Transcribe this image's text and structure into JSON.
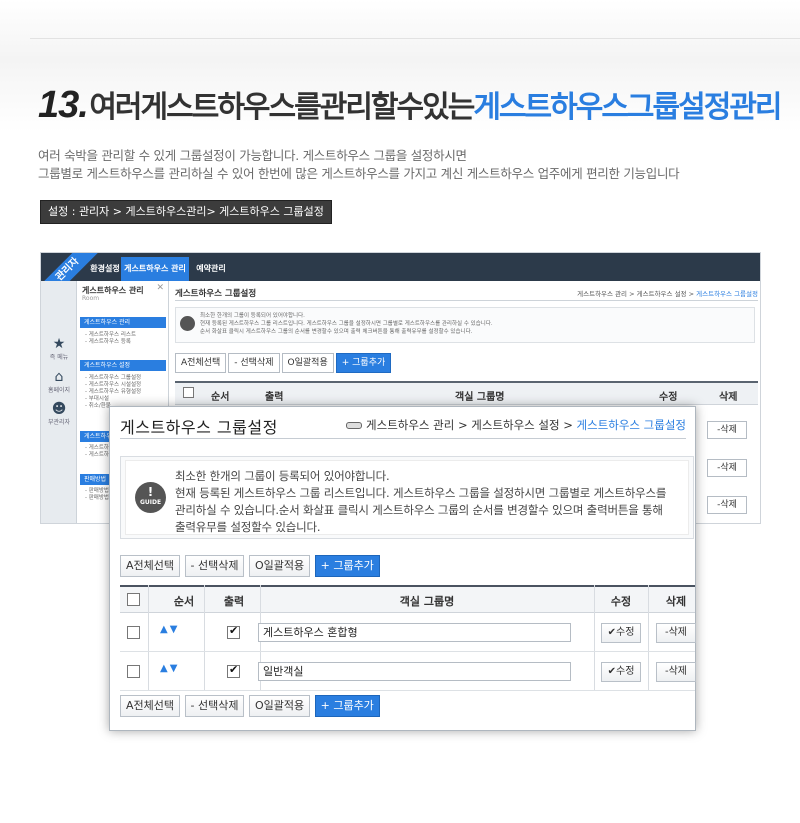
{
  "hero": {
    "number": "13.",
    "title_plain": "여러게스트하우스를관리할수있는",
    "title_accent": "게스트하우스그룹설정관리"
  },
  "description": {
    "line1": "여러 숙박을 관리할 수 있게 그룹설정이 가능합니다. 게스트하우스 그룹을 설정하시면",
    "line2": "그룹별로 게스트하우스를 관리하실 수 있어 한번에 많은 게스트하우스를 가지고 계신 게스트하우스 업주에게 편리한 기능입니다"
  },
  "path_box": "설정 : 관리자 > 게스트하우스관리> 게스트하우스 그룹설정",
  "background_app": {
    "ribbon": "관리자",
    "top_tabs": [
      "환경설정",
      "게스트하우스 관리",
      "예약관리"
    ],
    "icons": [
      {
        "glyph": "★",
        "label": "즉 메뉴",
        "icon": "star-icon"
      },
      {
        "glyph": "⌂",
        "label": "홈페이지",
        "icon": "home-icon"
      },
      {
        "glyph": "☻",
        "label": "부관리자",
        "icon": "user-icon"
      }
    ],
    "sidebar": {
      "title": "게스트하우스 관리",
      "subtitle": "Room",
      "sections": [
        {
          "label": "게스트하우스 관리",
          "items": [
            "- 게스트하우스 리스트",
            "- 게스트하우스 등록"
          ]
        },
        {
          "label": "게스트하우스 설정",
          "items": [
            "- 게스트하우스 그룹설정",
            "- 게스트하우스 시설설정",
            "- 게스트하우스 유형설정",
            "- 부대시설",
            "- 취소/환불"
          ]
        },
        {
          "label": "게스트하우",
          "items": [
            "- 게스트하",
            "- 게스트하"
          ]
        },
        {
          "label": "판매방법",
          "items": [
            "- 판매방법",
            "- 판매방법"
          ]
        }
      ]
    },
    "header_title": "게스트하우스 그룹설정",
    "header_crumb": {
      "a": "게스트하우스 관리",
      "b": "게스트하우스 설정",
      "current": "게스트하우스 그룹설정"
    },
    "guide_lines": [
      "최소한 한개의 그룹이 등록되어 있어야합니다.",
      "현재 등록된 게스트하우스 그룹 리스트입니다. 게스트하우스 그룹을 설정하시면 그룹별로 게스트하우스를 관리하실 수 있습니다.",
      "순서 화살표 클릭시 게스트하우스 그룹의 순서를 변경할수 있으며 출력 체크버튼을 통해 출력유무를 설정할수 있습니다."
    ],
    "buttons": [
      "A전체선택",
      "- 선택삭제",
      "O일괄적용",
      "+ 그룹추가"
    ],
    "columns": [
      "순서",
      "출력",
      "객실 그룹명",
      "수정",
      "삭제"
    ],
    "delete_label": "-삭제"
  },
  "panel": {
    "title": "게스트하우스 그룹설정",
    "crumb": {
      "a": "게스트하우스 관리",
      "sep": ">",
      "b": "게스트하우스 설정",
      "current": "게스트하우스 그룹설정"
    },
    "guide_label": "GUIDE",
    "guide_lines": [
      "최소한 한개의 그룹이 등록되어 있어야합니다.",
      "현재 등록된 게스트하우스 그룹 리스트입니다. 게스트하우스 그룹을 설정하시면 그룹별로 게스트하우스를",
      "관리하실 수 있습니다.순서 화살표 클릭시 게스트하우스 그룹의 순서를 변경할수 있으며 출력버튼을 통해",
      "출력유무를 설정할수 있습니다."
    ],
    "buttons": {
      "select_all": "A전체선택",
      "delete_selected": "- 선택삭제",
      "apply_all": "O일괄적용",
      "add_group": "+ 그룹추가"
    },
    "columns": {
      "order": "순서",
      "output": "출력",
      "name": "객실 그룹명",
      "edit": "수정",
      "delete": "삭제"
    },
    "rows": [
      {
        "name": "게스트하우스 혼합형",
        "output": true,
        "edit": "✔수정",
        "delete": "-삭제"
      },
      {
        "name": "일반객실",
        "output": true,
        "edit": "✔수정",
        "delete": "-삭제"
      }
    ],
    "order_arrows": "▲▼"
  },
  "colors": {
    "accent": "#2a7ee0",
    "dark_nav": "#2c3a4a",
    "path_box": "#3c3c3c"
  }
}
